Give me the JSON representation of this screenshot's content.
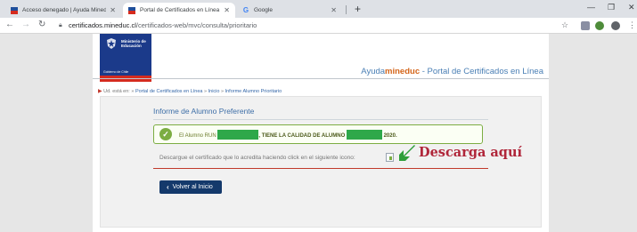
{
  "browser": {
    "tabs": [
      {
        "title": "Acceso denegado | Ayuda Mineduc",
        "icon": "chile-flag-icon",
        "active": false
      },
      {
        "title": "Portal de Certificados en Línea",
        "icon": "chile-flag-icon",
        "active": true
      },
      {
        "title": "Google",
        "icon": "google-icon",
        "active": false
      }
    ],
    "new_tab": "+",
    "url_host": "certificados.mineduc.cl",
    "url_path": "/certificados-web/mvc/consulta/prioritario"
  },
  "logo": {
    "line1": "Ministerio de",
    "line2": "Educación",
    "footer": "Gobierno de Chile"
  },
  "header": {
    "brand_prefix": "Ayuda",
    "brand": "mineduc",
    "suffix": " - Portal de Certificados en Línea"
  },
  "breadcrumb": {
    "prefix": "Ud. está en:",
    "sep": "»",
    "items": [
      "Portal de Certificados en Línea",
      "Inicio",
      "Informe Alumno Prioritario"
    ]
  },
  "panel": {
    "title": "Informe de Alumno Preferente",
    "alert_pre": "El Alumno RUN",
    "alert_strong": ", TIENE LA CALIDAD DE ALUMNO",
    "alert_year": "2020.",
    "download_text": "Descargue el certificado que lo acredita haciendo click en el siguiente icono:",
    "callout": "Descarga aquí",
    "button": "Volver al Inicio"
  },
  "colors": {
    "brand_orange": "#d4651a",
    "link_blue": "#3567a8",
    "alert_green": "#7cad42",
    "callout_red": "#b0263a",
    "button_navy": "#14396b"
  }
}
